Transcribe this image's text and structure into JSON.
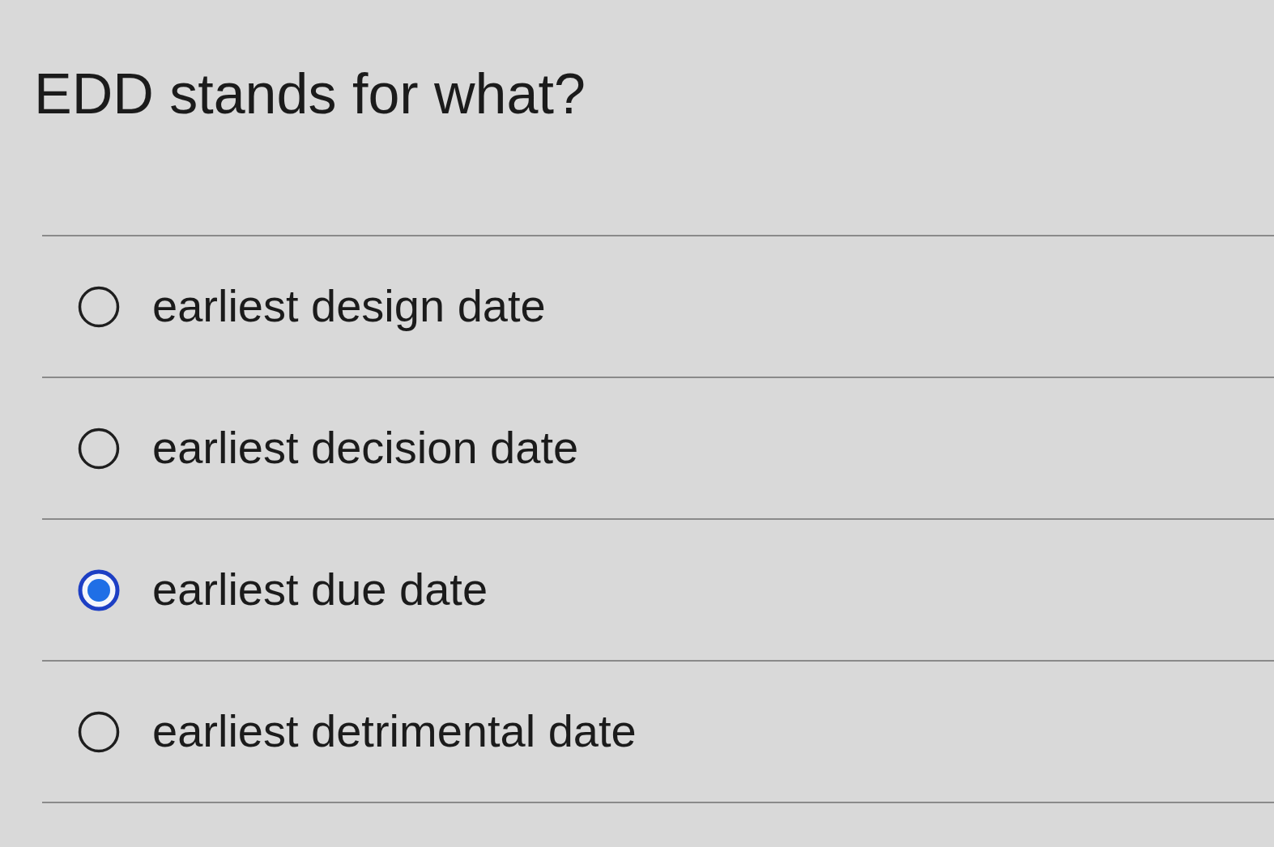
{
  "question": {
    "text": "EDD stands for what?"
  },
  "options": [
    {
      "label": "earliest design date",
      "selected": false
    },
    {
      "label": "earliest decision date",
      "selected": false
    },
    {
      "label": "earliest due date",
      "selected": true
    },
    {
      "label": "earliest detrimental date",
      "selected": false
    }
  ]
}
